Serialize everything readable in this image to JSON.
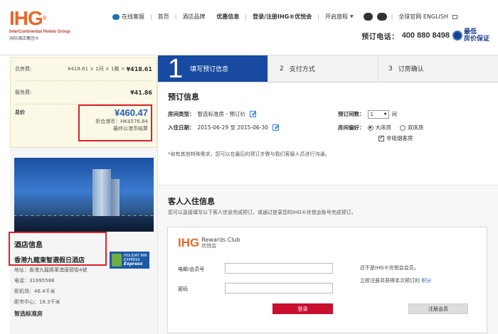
{
  "header": {
    "logo": {
      "mark": "IHG",
      "reg": "®",
      "en": "InterContinental Hotels Group",
      "cn": "洲际酒店集团®"
    },
    "nav": {
      "support": "在线客服",
      "home": "首页",
      "brands": "酒店品牌",
      "offers": "优惠信息",
      "login": "登录/注册IHG®优悦会",
      "itinerary": "开启旅程",
      "lang": "全球官网 ENGLISH"
    },
    "phone_label": "预订电话：",
    "phone_number": "400 880 8498",
    "best_price": [
      "最低",
      "房价保证"
    ]
  },
  "summary": {
    "total_price_label": "总房费:",
    "total_price_calc": "¥418.61 × 1间 × 1晚 =",
    "total_price_value": "¥418.61",
    "service_label": "服务费:",
    "service_value": "¥41.86",
    "grand_label": "总价",
    "grand_value": "¥460.47",
    "hkd_line": "折合港币：HK$576.84",
    "hkd_note": "最终以港币结算"
  },
  "hotel": {
    "info_title": "酒店信息",
    "name": "香港九龍東智選假日酒店",
    "brand_logo_text": [
      "HOLIDAY INN",
      "EXPRESS"
    ],
    "brand_logo_script": "Express",
    "address": "地址：香港九龍將軍澳唐德街4號",
    "phone": "电话：31995588",
    "airport": "距机场：46.4千米",
    "city_center": "距市中心：18.3千米",
    "room_type": "智选标准房"
  },
  "steps": [
    {
      "num": "1",
      "label": "填写预订信息"
    },
    {
      "num": "2",
      "label": "支付方式"
    },
    {
      "num": "3",
      "label": "订房确认"
    }
  ],
  "booking": {
    "title": "预订信息",
    "room_type_label": "房间类型：",
    "room_type_value": "智选标准房 - 预订价",
    "dates_label": "入住日期：",
    "dates_value": "2015-06-29 至 2015-06-30",
    "rooms_label": "预订间数：",
    "rooms_value": "1",
    "rooms_unit": "间",
    "pref_label": "房间偏好：",
    "pref_option1": "大床房",
    "pref_option2": "双床房",
    "non_smoking": "非吸烟客房",
    "note": "*如有其他特殊需求，您可以在最后的预订步骤与我们客服人员进行沟通。"
  },
  "guest": {
    "title": "客人入住信息",
    "desc": "您可以直接填写以下客人信息完成预订，或通过登录您的IHG®优悦会账号完成预订。",
    "rc_ihg": "IHG",
    "rc_name": "Rewards Club",
    "rc_cn": "优悦会",
    "email_label": "电邮/会员号",
    "password_label": "密码",
    "login_button": "登录",
    "reg_line1": "还不是IHG®优悦会会员，",
    "reg_line2": "立即注册并获得本次预订的",
    "reg_link": "积分",
    "register_button": "注册会员"
  }
}
